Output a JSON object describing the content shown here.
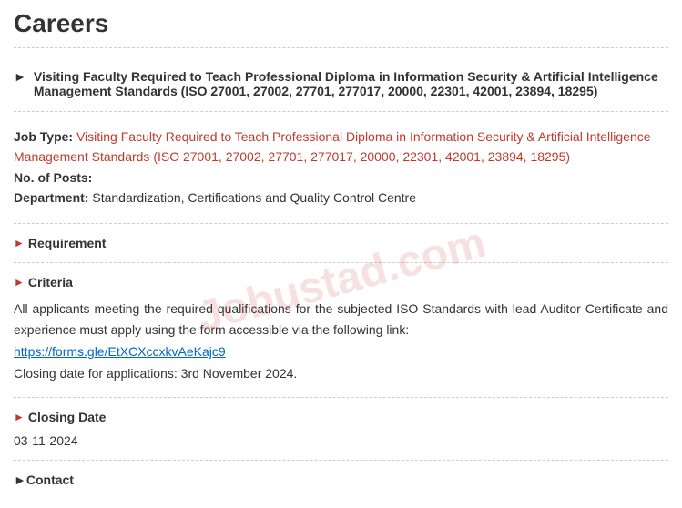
{
  "page": {
    "title": "Careers"
  },
  "job": {
    "title": "Visiting Faculty Required to Teach Professional Diploma in Information Security & Artificial Intelligence Management Standards (ISO 27001, 27002, 27701, 277017, 20000, 22301, 42001, 23894, 18295)",
    "type_label": "Job Type:",
    "type_value": "Visiting Faculty Required to Teach Professional Diploma in Information Security & Artificial Intelligence Management Standards (ISO 27001, 27002, 27701, 277017, 20000, 22301, 42001, 23894, 18295)",
    "posts_label": "No. of Posts:",
    "posts_value": "",
    "department_label": "Department:",
    "department_value": "Standardization, Certifications and Quality Control Centre"
  },
  "sections": {
    "requirement_label": "Requirement",
    "criteria_label": "Criteria",
    "criteria_text_1": "All applicants meeting the required qualifications for the subjected ISO Standards with lead Auditor Certificate and experience must apply using the form accessible via the following link:",
    "criteria_link_text": "https://forms.gle/EtXCXccxkvAeKajc9",
    "criteria_link_url": "https://forms.gle/EtXCXccxkvAeKajc9",
    "closing_date_note_label": "Closing date for applications:",
    "closing_date_note_value": "3rd November 2024.",
    "closing_date_label": "Closing Date",
    "closing_date_value": "03-11-2024",
    "contact_label": "Contact"
  },
  "watermark": "Jobustad.com"
}
